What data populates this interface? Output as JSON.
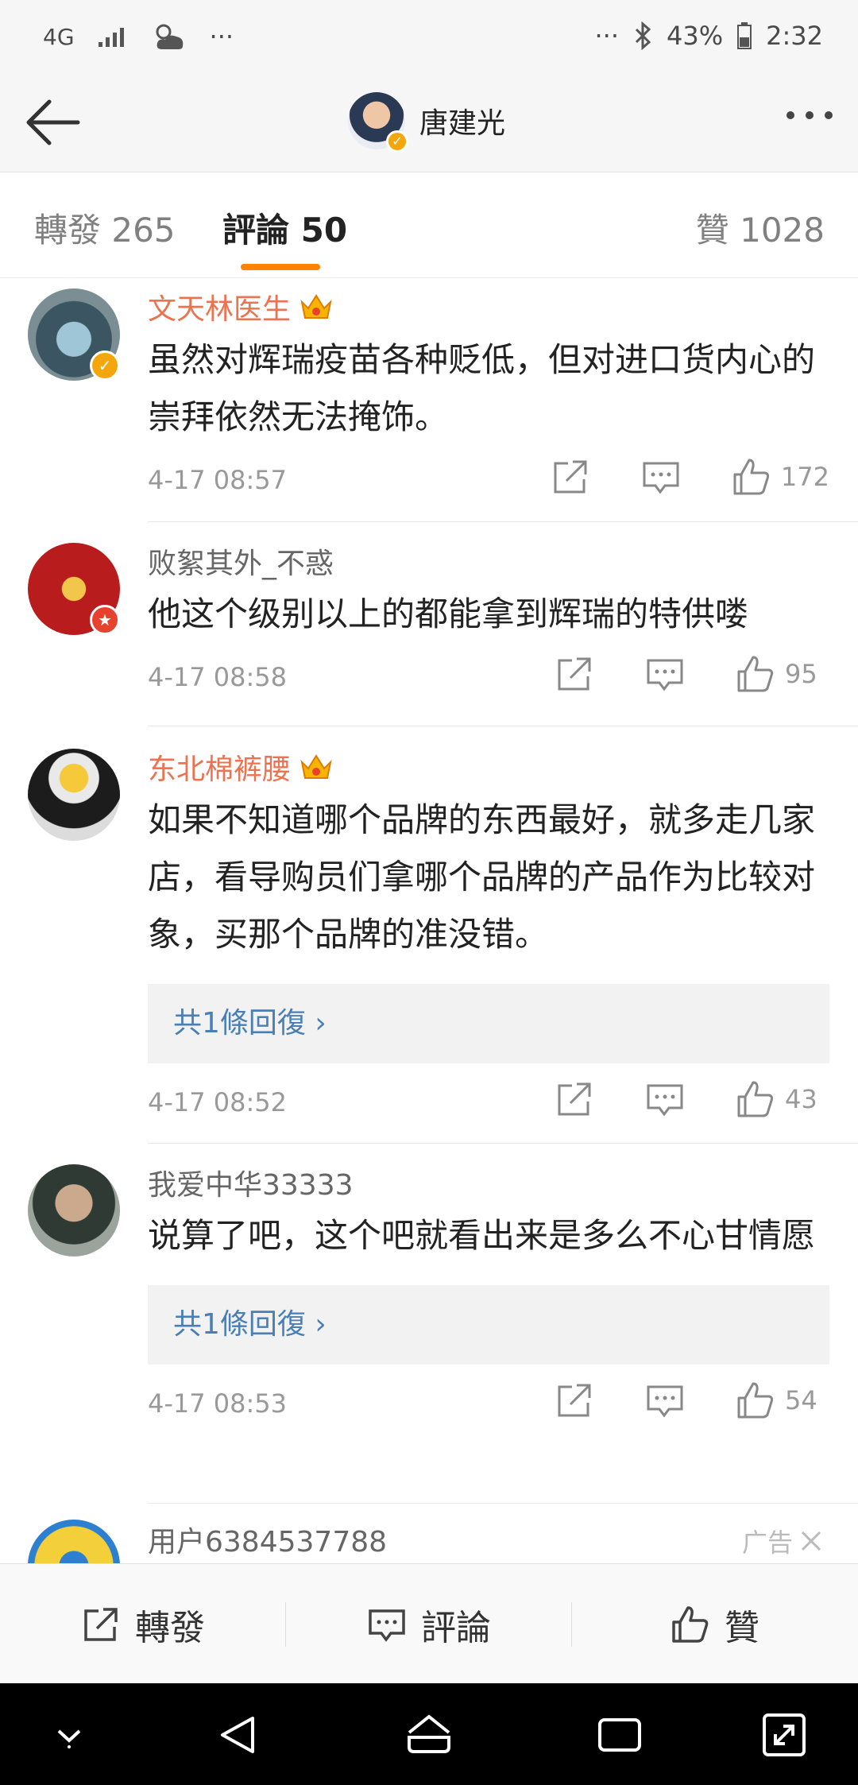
{
  "status_bar": {
    "network": "4G",
    "ellipsis_left": "···",
    "ellipsis_right": "···",
    "battery": "43%",
    "time": "2:32"
  },
  "header": {
    "title": "唐建光"
  },
  "tabs": [
    {
      "label": "轉發 265"
    },
    {
      "label": "評論 50"
    },
    {
      "label": "贊 1028"
    }
  ],
  "comments": [
    {
      "name": "文天林医生",
      "text": "虽然对辉瑞疫苗各种贬低，但对进口货内心的崇拜依然无法掩饰。",
      "time": "4-17 08:57",
      "likes": "172"
    },
    {
      "name": "败絮其外_不惑",
      "text": "他这个级别以上的都能拿到辉瑞的特供喽",
      "time": "4-17 08:58",
      "likes": "95"
    },
    {
      "name": "东北棉裤腰",
      "text": "如果不知道哪个品牌的东西最好，就多走几家店，看导购员们拿哪个品牌的产品作为比较对象，买那个品牌的准没错。",
      "reply": "共1條回復 ›",
      "time": "4-17 08:52",
      "likes": "43"
    },
    {
      "name": "我爱中华33333",
      "text": "说算了吧，这个吧就看出来是多么不心甘情愿",
      "reply": "共1條回復 ›",
      "time": "4-17 08:53",
      "likes": "54"
    },
    {
      "name": "用户6384537788",
      "ad": "广告"
    }
  ],
  "toolbar": {
    "repost": "轉發",
    "comment": "評論",
    "like": "贊"
  },
  "colors": {
    "accent": "#ff8200",
    "vip_name": "#eb7350",
    "link": "#4a7fb5",
    "verified_badge": "#f4a70d"
  }
}
